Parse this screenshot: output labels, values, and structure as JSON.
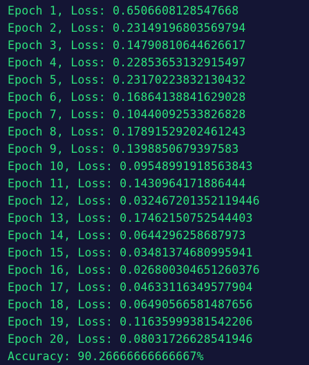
{
  "terminal": {
    "lines": [
      "Epoch 1, Loss: 0.6506608128547668",
      "Epoch 2, Loss: 0.23149196803569794",
      "Epoch 3, Loss: 0.14790810644626617",
      "Epoch 4, Loss: 0.22853653132915497",
      "Epoch 5, Loss: 0.23170223832130432",
      "Epoch 6, Loss: 0.16864138841629028",
      "Epoch 7, Loss: 0.10440092533826828",
      "Epoch 8, Loss: 0.17891529202461243",
      "Epoch 9, Loss: 0.1398850679397583",
      "Epoch 10, Loss: 0.09548991918563843",
      "Epoch 11, Loss: 0.1430964171886444",
      "Epoch 12, Loss: 0.032467201352119446",
      "Epoch 13, Loss: 0.17462150752544403",
      "Epoch 14, Loss: 0.0644296258687973",
      "Epoch 15, Loss: 0.03481374680995941",
      "Epoch 16, Loss: 0.026800304651260376",
      "Epoch 17, Loss: 0.04633116349577904",
      "Epoch 18, Loss: 0.06490566581487656",
      "Epoch 19, Loss: 0.11635999381542206",
      "Epoch 20, Loss: 0.08031726628541946"
    ],
    "accuracy_line": "Accuracy: 90.26666666666667%"
  },
  "colors": {
    "background": "#141534",
    "text": "#2de37d"
  }
}
